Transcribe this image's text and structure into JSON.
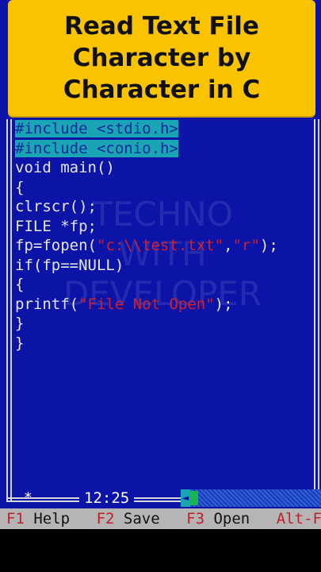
{
  "banner": {
    "line1": "Read Text File",
    "line2": "Character by",
    "line3": "Character in C"
  },
  "code": {
    "l1": "#include <stdio.h>",
    "l2": "#include <conio.h>",
    "l3_a": "void main()",
    "l4": "{",
    "l5": "clrscr();",
    "l6": "FILE *fp;",
    "l7_a": "fp=fopen(",
    "l7_s1": "\"c:\\\\test.txt\"",
    "l7_b": ",",
    "l7_s2": "\"r\"",
    "l7_c": ");",
    "l8": "if(fp==NULL)",
    "l9": "{",
    "l10_a": "printf(",
    "l10_s": "\"File Not Open\"",
    "l10_b": ");",
    "l11": "}",
    "l12": "}"
  },
  "watermark": {
    "line1": "TECHNO",
    "line2": "WITH",
    "line3": "DEVELOPER"
  },
  "status": {
    "position_marker": "*",
    "time": "12:25"
  },
  "fkeys": [
    {
      "key": "F1",
      "label": "Help"
    },
    {
      "key": "F2",
      "label": "Save"
    },
    {
      "key": "F3",
      "label": "Open"
    },
    {
      "key": "Alt-F",
      "label": ""
    }
  ],
  "colors": {
    "editor_bg": "#0c14a8",
    "banner_bg": "#f9c300",
    "highlight": "#1aa5b5",
    "string": "#d0202a"
  }
}
